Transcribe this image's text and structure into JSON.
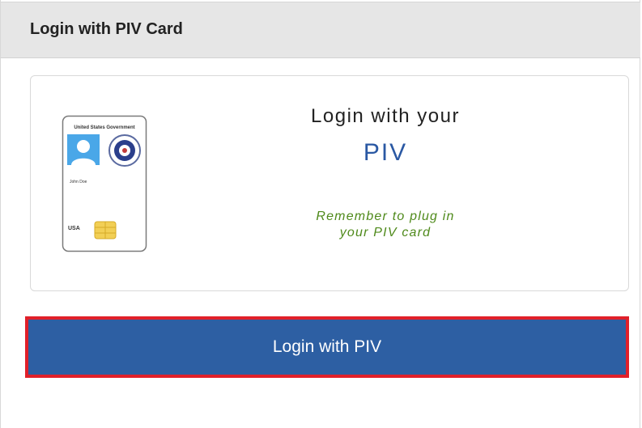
{
  "panel": {
    "title": "Login with PIV Card"
  },
  "piv_prompt": {
    "heading": "Login with your",
    "highlight": "PIV",
    "reminder_line1": "Remember to plug in",
    "reminder_line2": "your PIV card"
  },
  "card_illustration": {
    "header_text": "United States Government",
    "name_text": "John Doe",
    "country_text": "USA",
    "icons": [
      "person-photo-icon",
      "dhs-seal-icon",
      "chip-icon"
    ]
  },
  "actions": {
    "login_button_label": "Login with PIV"
  },
  "colors": {
    "header_bg": "#e6e6e6",
    "accent_blue": "#2d5fa3",
    "piv_text": "#2a58a3",
    "reminder_green": "#4f8a1b",
    "highlight_red": "#e0202a"
  }
}
